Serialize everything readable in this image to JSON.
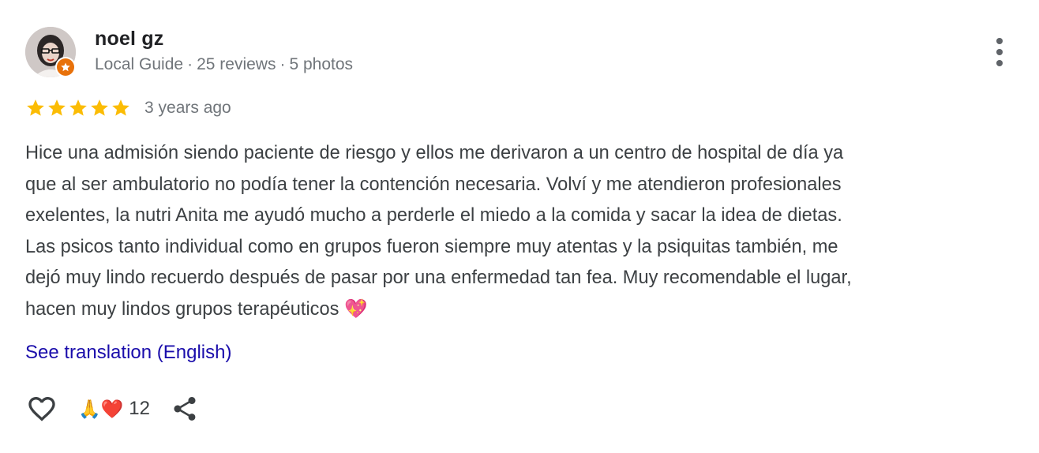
{
  "review": {
    "author": {
      "name": "noel gz",
      "badge": "Local Guide",
      "reviews": "25 reviews",
      "photos": "5 photos",
      "separator": "·",
      "avatar_icon": "user-photo-icon",
      "badge_icon": "local-guide-star-icon"
    },
    "rating": {
      "stars": 5,
      "max": 5,
      "star_color": "#fbbc04",
      "date": "3 years ago"
    },
    "text": "Hice una admisión siendo paciente de riesgo y ellos me derivaron a un centro de hospital de día ya\nque al ser ambulatorio no podía tener la contención necesaria. Volví y me atendieron profesionales\nexelentes, la nutri Anita me ayudó mucho a perderle el miedo a la comida y sacar la idea de dietas.\nLas psicos tanto individual como en grupos fueron siempre muy atentas y la psiquitas también, me\ndejó muy lindo recuerdo después de pasar por una enfermedad tan fea. Muy recomendable el lugar,\nhacen muy lindos grupos terapéuticos 💖",
    "translation_link": "See translation (English)",
    "reactions": {
      "emojis": "🙏❤️",
      "count": "12"
    },
    "icons": {
      "more": "more-vert-icon",
      "like": "heart-outline-icon",
      "share": "share-icon"
    },
    "colors": {
      "link": "#1a0dab",
      "badge": "#e8710a",
      "text": "#3c4043",
      "meta": "#70757a"
    }
  }
}
